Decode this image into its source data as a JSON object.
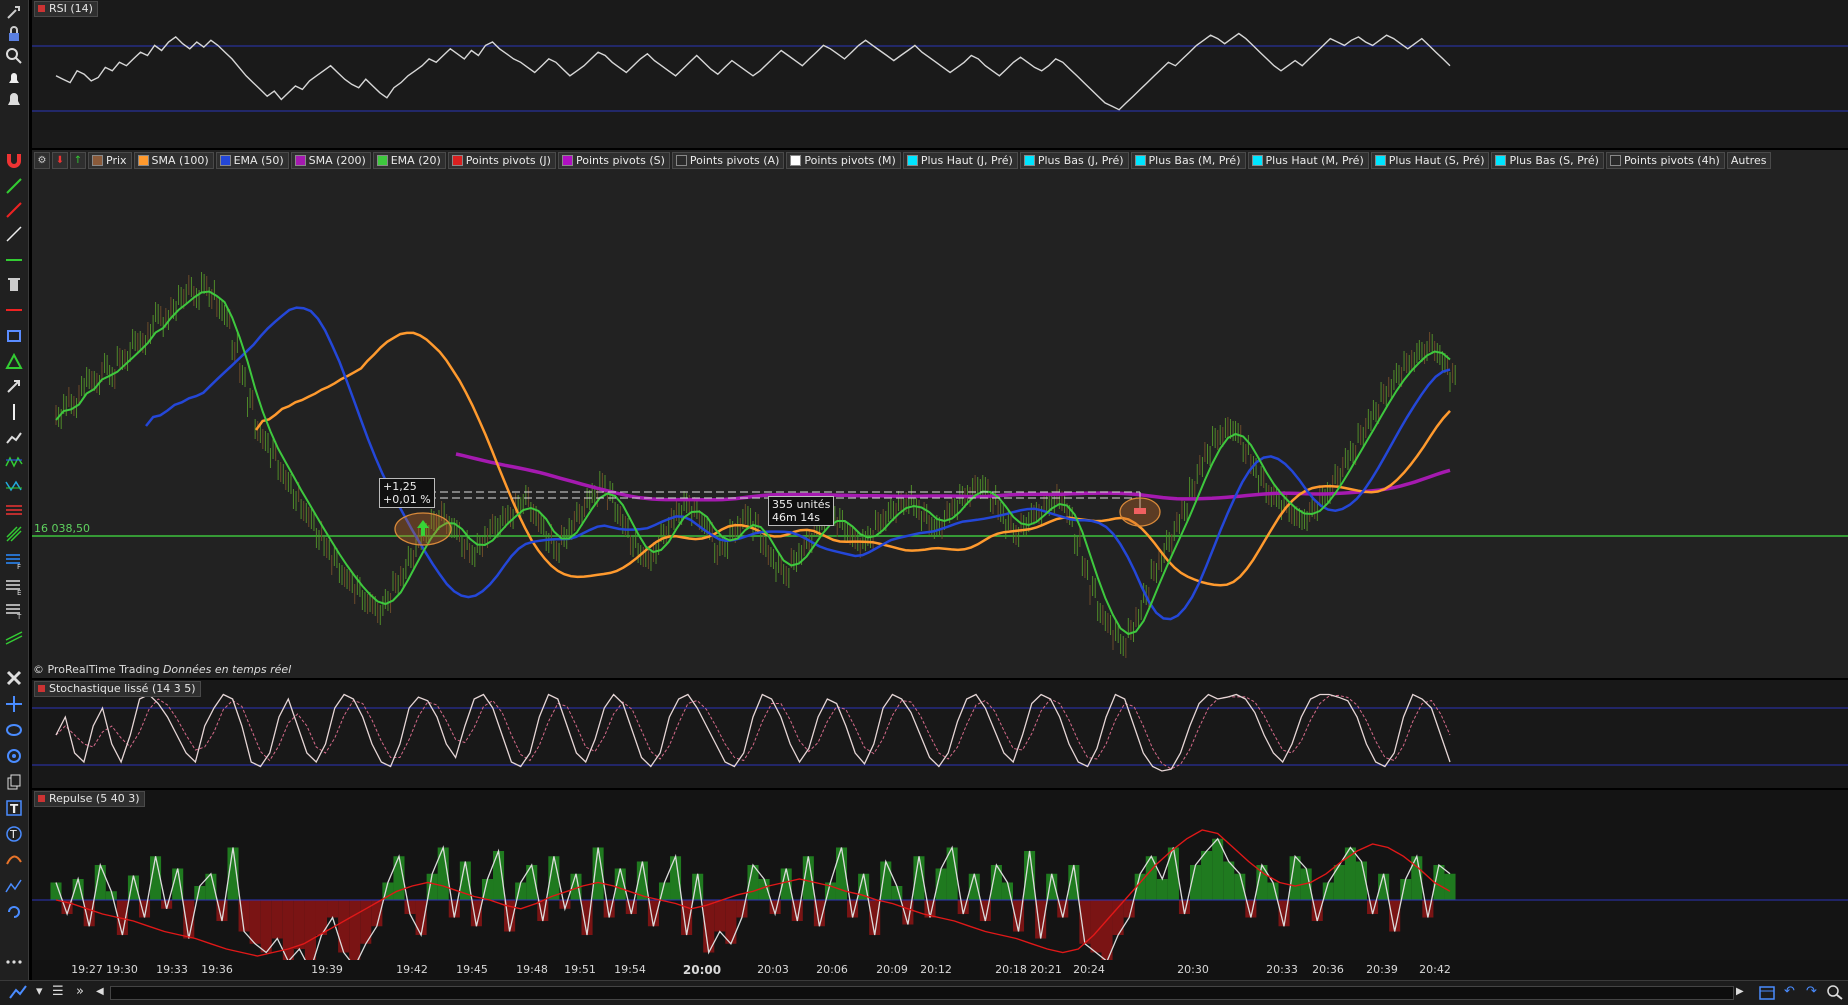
{
  "toolbar": {
    "icons": [
      "wrench-icon",
      "lock-icon",
      "zoom-icon",
      "alert-icon",
      "alert-settings-icon",
      "magnet-icon",
      "line-icon",
      "red-line-icon",
      "segment-icon",
      "horizontal-line-icon",
      "trash-icon",
      "red-horizontal-icon",
      "rectangle-icon",
      "triangle-icon",
      "arrow-icon",
      "vertical-line-icon",
      "polyline-icon",
      "wave-icon",
      "zigzag-icon",
      "fibonacci-fan-icon",
      "pitchfork-icon",
      "fib-retracement-icon",
      "fib-extension-icon",
      "fib-time-icon",
      "channel-icon",
      "tools-icon",
      "move-icon",
      "ellipse-icon",
      "gann-icon",
      "copy-icon",
      "text-icon",
      "label-icon",
      "curve-icon",
      "regression-icon",
      "undo-draw-icon",
      "more-icon"
    ]
  },
  "rsi": {
    "title": "RSI (14)",
    "series": [
      52,
      50,
      48,
      55,
      53,
      49,
      51,
      57,
      55,
      60,
      58,
      62,
      66,
      64,
      70,
      67,
      72,
      75,
      71,
      68,
      72,
      69,
      73,
      70,
      66,
      62,
      57,
      52,
      48,
      44,
      40,
      43,
      38,
      42,
      46,
      44,
      49,
      52,
      55,
      58,
      54,
      50,
      47,
      45,
      50,
      46,
      42,
      39,
      45,
      48,
      52,
      55,
      58,
      62,
      60,
      64,
      68,
      65,
      62,
      67,
      64,
      70,
      72,
      68,
      65,
      62,
      60,
      57,
      54,
      58,
      62,
      60,
      56,
      52,
      55,
      58,
      62,
      66,
      64,
      60,
      57,
      54,
      58,
      62,
      65,
      61,
      58,
      55,
      52,
      56,
      60,
      64,
      60,
      56,
      53,
      57,
      61,
      58,
      55,
      52,
      55,
      59,
      63,
      67,
      64,
      61,
      58,
      62,
      66,
      70,
      68,
      65,
      62,
      66,
      70,
      73,
      70,
      67,
      64,
      61,
      64,
      67,
      70,
      66,
      63,
      60,
      57,
      54,
      57,
      60,
      64,
      62,
      58,
      55,
      52,
      56,
      60,
      63,
      60,
      57,
      55,
      58,
      62,
      60,
      56,
      52,
      48,
      44,
      40,
      36,
      34,
      32,
      36,
      40,
      44,
      48,
      52,
      56,
      60,
      58,
      62,
      66,
      70,
      73,
      76,
      74,
      71,
      74,
      77,
      74,
      70,
      66,
      62,
      58,
      55,
      58,
      61,
      58,
      62,
      66,
      70,
      74,
      72,
      70,
      73,
      75,
      72,
      70,
      73,
      76,
      74,
      71,
      68,
      71,
      74,
      70,
      66,
      62,
      58
    ]
  },
  "price": {
    "legend": [
      {
        "label": "Prix",
        "color": "#8a5a3a"
      },
      {
        "label": "SMA (100)",
        "color": "#ff9a2e"
      },
      {
        "label": "EMA (50)",
        "color": "#2447d8"
      },
      {
        "label": "SMA (200)",
        "color": "#a51ab0"
      },
      {
        "label": "EMA (20)",
        "color": "#3ec83e"
      },
      {
        "label": "Points pivots (J)",
        "color": "#d92020"
      },
      {
        "label": "Points pivots (S)",
        "color": "#b10fc2"
      },
      {
        "label": "Points pivots (A)",
        "color": "#2a2a2a"
      },
      {
        "label": "Points pivots (M)",
        "color": "#ffffff"
      },
      {
        "label": "Plus Haut (J, Pré)",
        "color": "#00e5ff"
      },
      {
        "label": "Plus Bas (J, Pré)",
        "color": "#00e5ff"
      },
      {
        "label": "Plus Bas (M, Pré)",
        "color": "#00e5ff"
      },
      {
        "label": "Plus Haut (M, Pré)",
        "color": "#00e5ff"
      },
      {
        "label": "Plus Haut (S, Pré)",
        "color": "#00e5ff"
      },
      {
        "label": "Plus Bas (S, Pré)",
        "color": "#00e5ff"
      },
      {
        "label": "Points pivots (4h)",
        "color": "#2a2a2a"
      },
      {
        "label": "Autres",
        "color": ""
      }
    ],
    "level_label": "16 038,50",
    "trade": {
      "entry_label_1": "+1,25",
      "entry_label_2": "+0,01 %",
      "info_label_1": "355 unités",
      "info_label_2": "46m 14s"
    },
    "series": {
      "close": [
        250,
        232,
        236,
        220,
        206,
        214,
        198,
        205,
        190,
        186,
        170,
        176,
        160,
        144,
        152,
        136,
        128,
        120,
        126,
        116,
        124,
        138,
        150,
        178,
        205,
        232,
        258,
        272,
        284,
        300,
        314,
        326,
        340,
        352,
        366,
        378,
        390,
        402,
        412,
        420,
        430,
        436,
        440,
        430,
        416,
        404,
        388,
        372,
        360,
        352,
        346,
        354,
        362,
        374,
        384,
        378,
        364,
        356,
        350,
        344,
        336,
        330,
        342,
        356,
        368,
        380,
        370,
        356,
        344,
        332,
        322,
        314,
        326,
        342,
        358,
        372,
        384,
        392,
        380,
        364,
        352,
        340,
        334,
        342,
        350,
        362,
        380,
        376,
        364,
        354,
        346,
        356,
        372,
        388,
        398,
        404,
        392,
        380,
        370,
        360,
        348,
        344,
        352,
        360,
        370,
        374,
        366,
        354,
        346,
        340,
        336,
        330,
        338,
        346,
        354,
        358,
        346,
        336,
        328,
        322,
        316,
        320,
        330,
        342,
        354,
        362,
        356,
        348,
        342,
        336,
        328,
        330,
        348,
        372,
        398,
        420,
        440,
        454,
        466,
        474,
        462,
        444,
        424,
        404,
        388,
        372,
        356,
        338,
        320,
        300,
        282,
        270,
        262,
        258,
        266,
        280,
        296,
        310,
        322,
        328,
        336,
        342,
        350,
        346,
        338,
        330,
        320,
        306,
        292,
        280,
        266,
        254,
        240,
        226,
        214,
        204,
        196,
        188,
        182,
        176,
        180,
        194,
        208
      ]
    }
  },
  "stoch": {
    "title": "Stochastique lissé (14 3 5)",
    "series": [
      50,
      70,
      30,
      20,
      60,
      80,
      40,
      20,
      50,
      90,
      95,
      85,
      70,
      50,
      30,
      20,
      60,
      80,
      95,
      90,
      60,
      20,
      15,
      30,
      70,
      90,
      60,
      30,
      20,
      40,
      80,
      95,
      90,
      70,
      40,
      20,
      15,
      40,
      80,
      92,
      88,
      70,
      40,
      25,
      60,
      90,
      95,
      80,
      50,
      20,
      15,
      30,
      70,
      95,
      90,
      60,
      30,
      20,
      45,
      80,
      95,
      85,
      55,
      25,
      15,
      30,
      70,
      90,
      95,
      80,
      60,
      40,
      20,
      15,
      30,
      70,
      95,
      90,
      70,
      40,
      20,
      35,
      70,
      90,
      85,
      60,
      30,
      18,
      40,
      80,
      95,
      90,
      75,
      50,
      25,
      15,
      30,
      65,
      90,
      95,
      80,
      55,
      30,
      20,
      50,
      85,
      95,
      90,
      70,
      40,
      20,
      15,
      35,
      70,
      95,
      90,
      60,
      30,
      15,
      10,
      12,
      30,
      60,
      85,
      95,
      90,
      92,
      95,
      90,
      75,
      50,
      30,
      20,
      40,
      70,
      90,
      95,
      95,
      92,
      88,
      70,
      40,
      20,
      15,
      30,
      70,
      95,
      90,
      80,
      50,
      20
    ]
  },
  "repulse": {
    "title": "Repulse (5 40 3)",
    "fast": [
      10,
      -8,
      12,
      -15,
      20,
      5,
      -20,
      14,
      -10,
      25,
      -5,
      18,
      -22,
      8,
      15,
      -12,
      30,
      -18,
      -25,
      -30,
      -22,
      -35,
      -28,
      -40,
      -20,
      -10,
      -30,
      -38,
      -25,
      -15,
      10,
      25,
      -8,
      -20,
      15,
      30,
      -10,
      22,
      -15,
      12,
      28,
      -18,
      10,
      20,
      -12,
      25,
      -5,
      15,
      -20,
      30,
      -10,
      18,
      -8,
      22,
      -15,
      10,
      25,
      -20,
      15,
      -30,
      -18,
      -25,
      -10,
      20,
      12,
      -8,
      18,
      -12,
      25,
      -15,
      10,
      30,
      -10,
      15,
      -20,
      22,
      8,
      -14,
      25,
      -10,
      18,
      30,
      -8,
      15,
      -12,
      20,
      10,
      -18,
      28,
      -22,
      15,
      -10,
      20,
      -25,
      -30,
      -35,
      -20,
      -10,
      15,
      25,
      12,
      30,
      -8,
      20,
      28,
      35,
      22,
      15,
      -10,
      20,
      10,
      -15,
      25,
      18,
      -12,
      10,
      20,
      30,
      22,
      -8,
      15,
      -18,
      12,
      25,
      -10,
      20,
      15
    ],
    "slow": [
      0,
      -2,
      -5,
      -8,
      -10,
      -12,
      -15,
      -18,
      -20,
      -22,
      -25,
      -28,
      -30,
      -32,
      -30,
      -28,
      -25,
      -20,
      -15,
      -10,
      -5,
      0,
      5,
      8,
      10,
      8,
      5,
      2,
      0,
      -3,
      -5,
      -2,
      2,
      5,
      8,
      10,
      8,
      5,
      2,
      0,
      -2,
      -5,
      -3,
      0,
      3,
      5,
      8,
      10,
      12,
      10,
      8,
      5,
      3,
      0,
      -2,
      -5,
      -8,
      -10,
      -12,
      -15,
      -18,
      -20,
      -22,
      -25,
      -28,
      -30,
      -28,
      -20,
      -10,
      0,
      10,
      20,
      28,
      35,
      40,
      38,
      30,
      22,
      15,
      10,
      8,
      10,
      15,
      22,
      28,
      32,
      30,
      25,
      18,
      10,
      5
    ]
  },
  "xaxis": [
    "19:27",
    "19:30",
    "19:33",
    "19:36",
    "19:39",
    "19:42",
    "19:45",
    "19:48",
    "19:51",
    "19:54",
    "20:00",
    "20:03",
    "20:06",
    "20:09",
    "20:12",
    "20:18",
    "20:21",
    "20:24",
    "20:30",
    "20:33",
    "20:36",
    "20:39",
    "20:42"
  ],
  "bottombar": {
    "icons": [
      "chart-type-icon",
      "menu-icon",
      "forward-icon",
      "calendar-icon",
      "undo-icon",
      "redo-icon",
      "zoom-fit-icon"
    ]
  }
}
